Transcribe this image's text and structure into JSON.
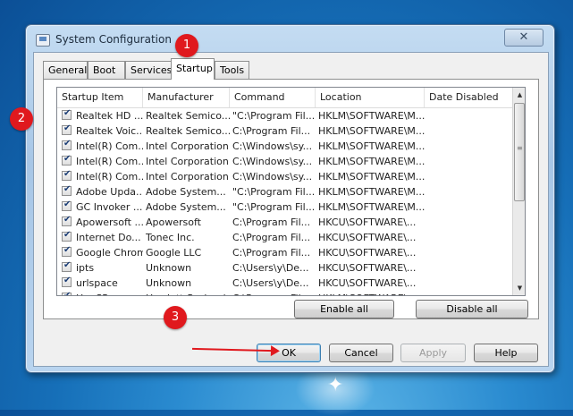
{
  "window": {
    "title": "System Configuration",
    "close_glyph": "✕"
  },
  "tabs": [
    {
      "label": "General",
      "active": false
    },
    {
      "label": "Boot",
      "active": false
    },
    {
      "label": "Services",
      "active": false
    },
    {
      "label": "Startup",
      "active": true
    },
    {
      "label": "Tools",
      "active": false
    }
  ],
  "startup_table": {
    "columns": [
      "Startup Item",
      "Manufacturer",
      "Command",
      "Location",
      "Date Disabled"
    ],
    "rows": [
      {
        "item": "Realtek HD ...",
        "manufacturer": "Realtek Semico...",
        "command": "\"C:\\Program Fil...",
        "location": "HKLM\\SOFTWARE\\M...",
        "date_disabled": "",
        "checked": true
      },
      {
        "item": "Realtek Voic...",
        "manufacturer": "Realtek Semico...",
        "command": "C:\\Program Fil...",
        "location": "HKLM\\SOFTWARE\\M...",
        "date_disabled": "",
        "checked": true
      },
      {
        "item": "Intel(R) Com...",
        "manufacturer": "Intel Corporation",
        "command": "C:\\Windows\\sy...",
        "location": "HKLM\\SOFTWARE\\M...",
        "date_disabled": "",
        "checked": true
      },
      {
        "item": "Intel(R) Com...",
        "manufacturer": "Intel Corporation",
        "command": "C:\\Windows\\sy...",
        "location": "HKLM\\SOFTWARE\\M...",
        "date_disabled": "",
        "checked": true
      },
      {
        "item": "Intel(R) Com...",
        "manufacturer": "Intel Corporation",
        "command": "C:\\Windows\\sy...",
        "location": "HKLM\\SOFTWARE\\M...",
        "date_disabled": "",
        "checked": true
      },
      {
        "item": "Adobe Upda...",
        "manufacturer": "Adobe System...",
        "command": "\"C:\\Program Fil...",
        "location": "HKLM\\SOFTWARE\\M...",
        "date_disabled": "",
        "checked": true
      },
      {
        "item": "GC Invoker ...",
        "manufacturer": "Adobe System...",
        "command": "\"C:\\Program Fil...",
        "location": "HKLM\\SOFTWARE\\M...",
        "date_disabled": "",
        "checked": true
      },
      {
        "item": "Apowersoft ...",
        "manufacturer": "Apowersoft",
        "command": "C:\\Program Fil...",
        "location": "HKCU\\SOFTWARE\\...",
        "date_disabled": "",
        "checked": true
      },
      {
        "item": "Internet Do...",
        "manufacturer": "Tonec Inc.",
        "command": "C:\\Program Fil...",
        "location": "HKCU\\SOFTWARE\\...",
        "date_disabled": "",
        "checked": true
      },
      {
        "item": "Google Chrome",
        "manufacturer": "Google LLC",
        "command": "C:\\Program Fil...",
        "location": "HKCU\\SOFTWARE\\...",
        "date_disabled": "",
        "checked": true
      },
      {
        "item": "ipts",
        "manufacturer": "Unknown",
        "command": "C:\\Users\\y\\De...",
        "location": "HKCU\\SOFTWARE\\...",
        "date_disabled": "",
        "checked": true
      },
      {
        "item": "urlspace",
        "manufacturer": "Unknown",
        "command": "C:\\Users\\y\\De...",
        "location": "HKCU\\SOFTWARE\\...",
        "date_disabled": "",
        "checked": true
      },
      {
        "item": "HpqSRmon",
        "manufacturer": "Hewlett-Packard",
        "command": "C:\\Program Fil...",
        "location": "HKLM\\SOFTWARE\\...",
        "date_disabled": "",
        "checked": true
      }
    ]
  },
  "panel_buttons": {
    "enable_all": "Enable all",
    "disable_all": "Disable all"
  },
  "dialog_buttons": {
    "ok": "OK",
    "cancel": "Cancel",
    "apply": "Apply",
    "help": "Help"
  },
  "scrollbar": {
    "up_glyph": "▲",
    "down_glyph": "▼",
    "grip_glyph": "≡"
  },
  "annotations": {
    "marker_1": "1",
    "marker_2": "2",
    "marker_3": "3",
    "color": "#e0191e"
  }
}
